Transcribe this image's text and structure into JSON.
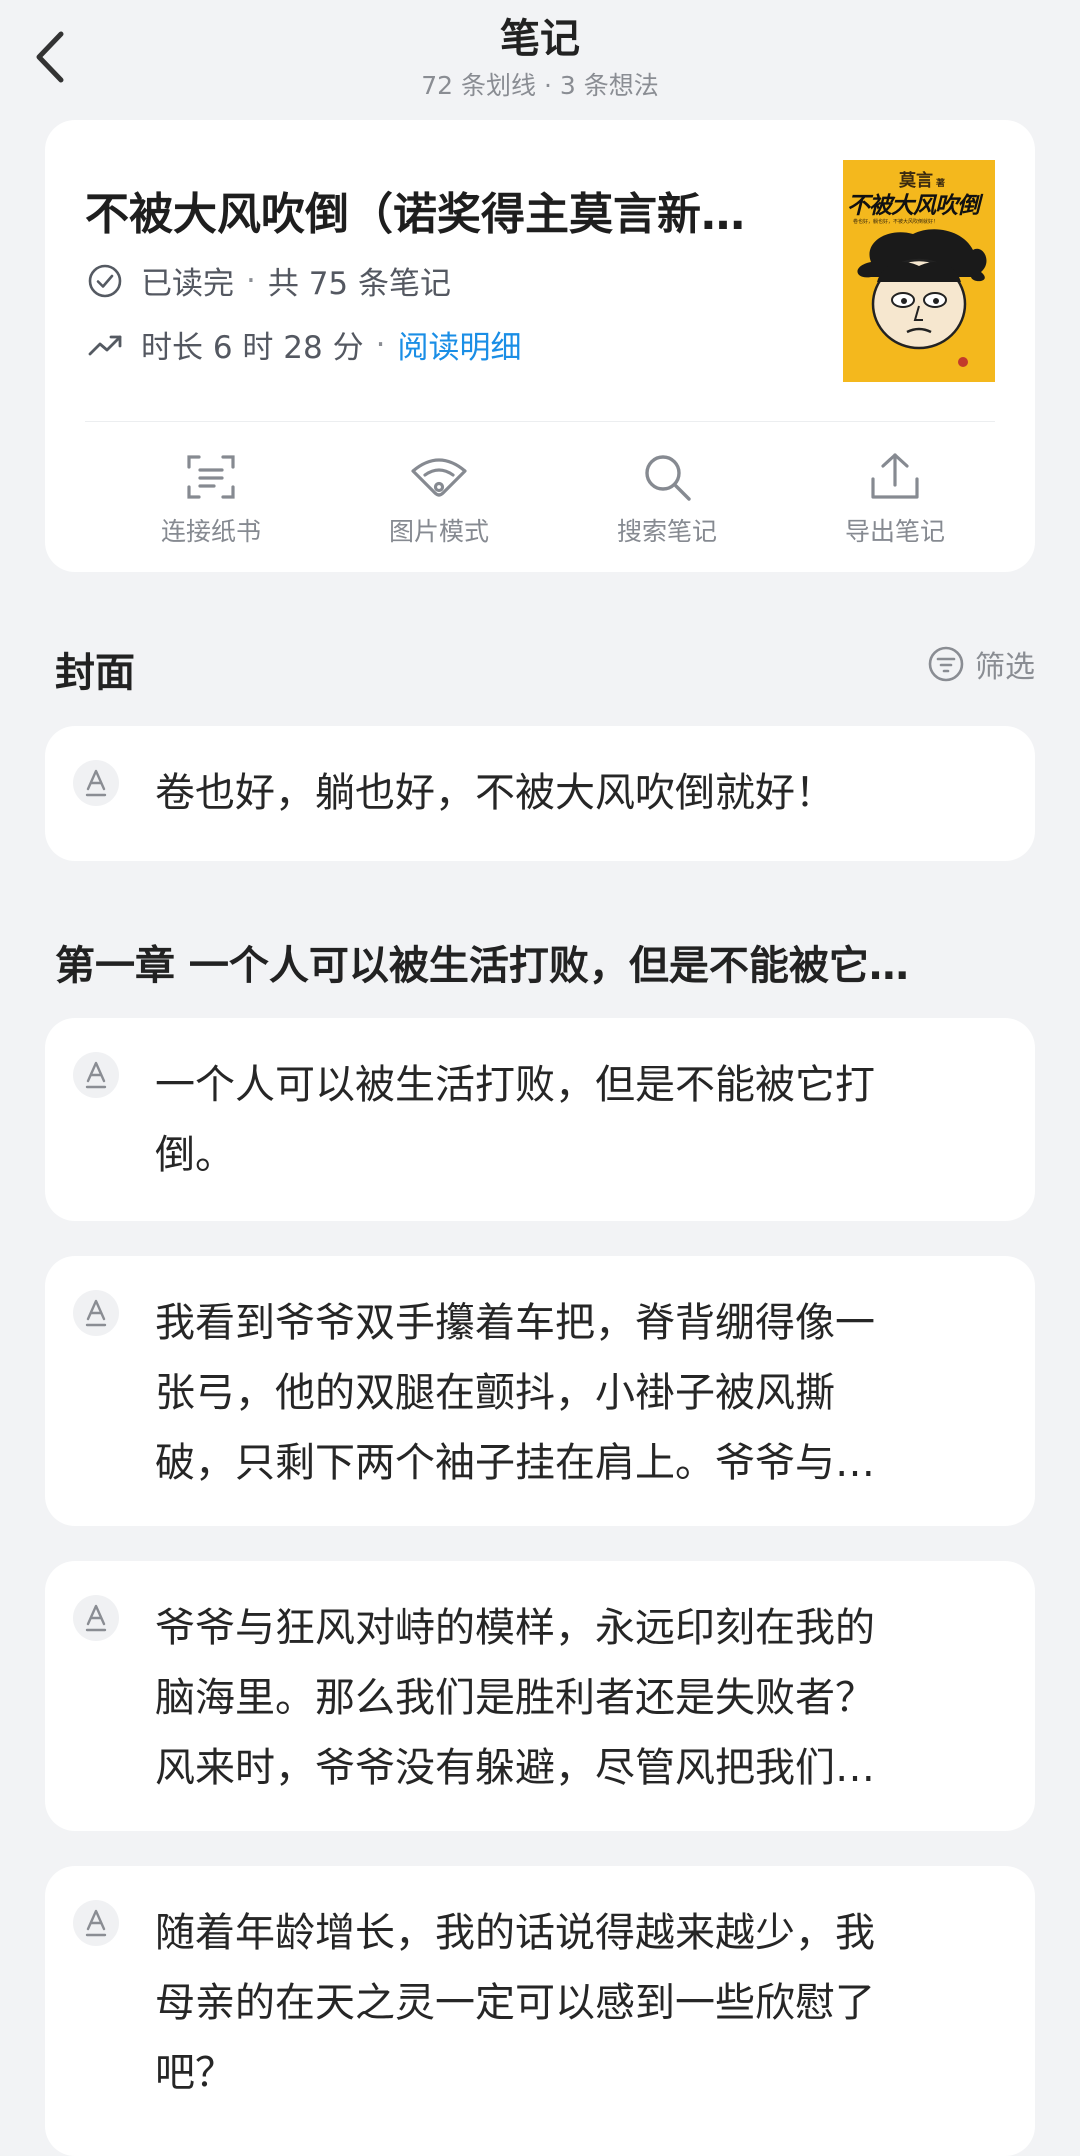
{
  "header": {
    "title": "笔记",
    "subtitle": "72 条划线 · 3 条想法"
  },
  "book": {
    "title": "不被大风吹倒（诺奖得主莫言新…",
    "status": "已读完",
    "note_count": "共 75 条笔记",
    "duration": "时长 6 时 28 分",
    "detail_link": "阅读明细",
    "cover": {
      "author": "莫言",
      "author_suffix": "著",
      "title": "不被大风吹倒",
      "tagline": "卷也好，躺也好，不被大风吹倒就好！"
    }
  },
  "actions": [
    {
      "label": "连接纸书",
      "icon": "scan-icon"
    },
    {
      "label": "图片模式",
      "icon": "fan-image-icon"
    },
    {
      "label": "搜索笔记",
      "icon": "search-icon"
    },
    {
      "label": "导出笔记",
      "icon": "export-icon"
    }
  ],
  "filter_label": "筛选",
  "sections": [
    {
      "title": "封面",
      "notes": [
        {
          "lines": [
            "卷也好，躺也好，不被大风吹倒就好！"
          ]
        }
      ]
    },
    {
      "title": "第一章 一个人可以被生活打败，但是不能被它…",
      "notes": [
        {
          "lines": [
            "一个人可以被生活打败，但是不能被它打",
            "倒。"
          ]
        },
        {
          "lines": [
            "我看到爷爷双手攥着车把，脊背绷得像一",
            "张弓，他的双腿在颤抖，小褂子被风撕",
            "破，只剩下两个袖子挂在肩上。爷爷与…"
          ]
        },
        {
          "lines": [
            "爷爷与狂风对峙的模样，永远印刻在我的",
            "脑海里。那么我们是胜利者还是失败者？",
            "风来时，爷爷没有躲避，尽管风把我们…"
          ]
        },
        {
          "lines": [
            "随着年龄增长，我的话说得越来越少，我",
            "母亲的在天之灵一定可以感到一些欣慰了",
            "吧？"
          ]
        }
      ]
    }
  ],
  "colors": {
    "background": "#f2f3f5",
    "card": "#ffffff",
    "link": "#1a8ee6",
    "cover": "#f4b81d"
  }
}
